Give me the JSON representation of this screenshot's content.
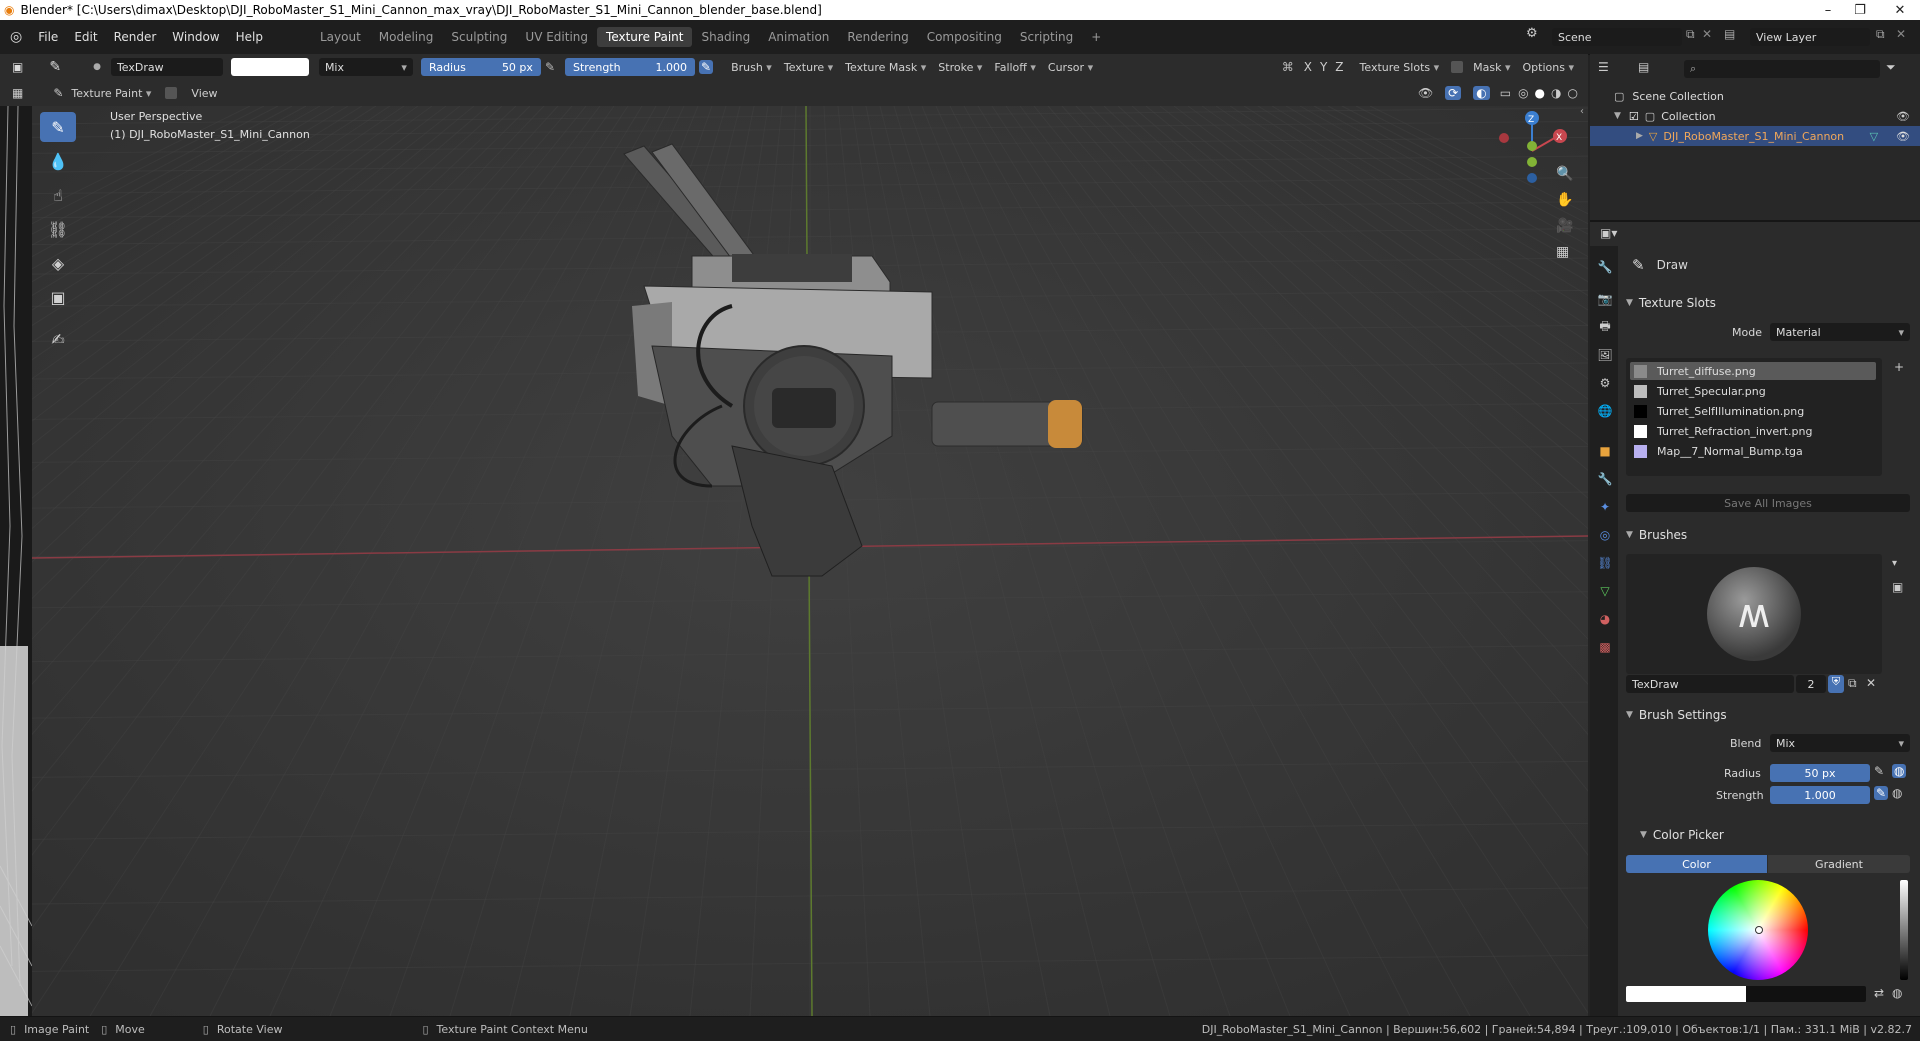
{
  "window": {
    "title": "Blender* [C:\\Users\\dimax\\Desktop\\DJI_RoboMaster_S1_Mini_Cannon_max_vray\\DJI_RoboMaster_S1_Mini_Cannon_blender_base.blend]"
  },
  "menubar": {
    "menus": [
      "File",
      "Edit",
      "Render",
      "Window",
      "Help"
    ],
    "workspaces": [
      "Layout",
      "Modeling",
      "Sculpting",
      "UV Editing",
      "Texture Paint",
      "Shading",
      "Animation",
      "Rendering",
      "Compositing",
      "Scripting"
    ],
    "active_workspace": "Texture Paint",
    "add_symbol": "+",
    "scene_label": "Scene",
    "view_layer_label": "View Layer"
  },
  "toolheader": {
    "brush_name": "TexDraw",
    "blend_mode": "Mix",
    "radius_label": "Radius",
    "radius_value": "50 px",
    "strength_label": "Strength",
    "strength_value": "1.000",
    "dropdowns": [
      "Brush",
      "Texture",
      "Texture Mask",
      "Stroke",
      "Falloff",
      "Cursor"
    ],
    "axis": [
      "X",
      "Y",
      "Z"
    ],
    "right_dropdowns": [
      "Texture Slots",
      "Mask",
      "Options"
    ]
  },
  "viewheader": {
    "mode": "Texture Paint",
    "view_menu": "View"
  },
  "viewport": {
    "perspective": "User Perspective",
    "object_label": "(1) DJI_RoboMaster_S1_Mini_Cannon",
    "gizmo": {
      "x": "X",
      "y": "Y",
      "z": "Z"
    }
  },
  "outliner": {
    "scene_collection": "Scene Collection",
    "collection": "Collection",
    "object": "DJI_RoboMaster_S1_Mini_Cannon"
  },
  "properties": {
    "tool_name": "Draw",
    "texture_slots_title": "Texture Slots",
    "mode_label": "Mode",
    "mode_value": "Material",
    "slots": [
      {
        "name": "Turret_diffuse.png",
        "swatch": "#8a8a8a"
      },
      {
        "name": "Turret_Specular.png",
        "swatch": "#bdbdbd"
      },
      {
        "name": "Turret_SelfIllumination.png",
        "swatch": "#000000"
      },
      {
        "name": "Turret_Refraction_invert.png",
        "swatch": "#ffffff"
      },
      {
        "name": "Map__7_Normal_Bump.tga",
        "swatch": "#b8b0f0"
      }
    ],
    "save_all_images": "Save All Images",
    "brushes_title": "Brushes",
    "brush_name": "TexDraw",
    "brush_users": "2",
    "brush_settings_title": "Brush Settings",
    "blend_label": "Blend",
    "blend_value": "Mix",
    "radius_label": "Radius",
    "radius_value": "50 px",
    "strength_label": "Strength",
    "strength_value": "1.000",
    "color_picker_title": "Color Picker",
    "color_tab": "Color",
    "gradient_tab": "Gradient"
  },
  "statusbar": {
    "image_paint": "Image Paint",
    "move": "Move",
    "rotate_view": "Rotate View",
    "context_menu": "Texture Paint Context Menu",
    "stats": "DJI_RoboMaster_S1_Mini_Cannon | Вершин:56,602 | Граней:54,894 | Треуг.:109,010 | Объектов:1/1 | Пам.: 331.1 MiB | v2.82.7"
  },
  "colors": {
    "accent": "#4772b3",
    "viewport_bg": "#3a3a3a",
    "header_bg": "#2c2c2c",
    "axis_x": "#c8474f",
    "axis_y": "#82b336",
    "axis_z": "#3b7fd1",
    "cannon_tip": "#c88a3a"
  }
}
